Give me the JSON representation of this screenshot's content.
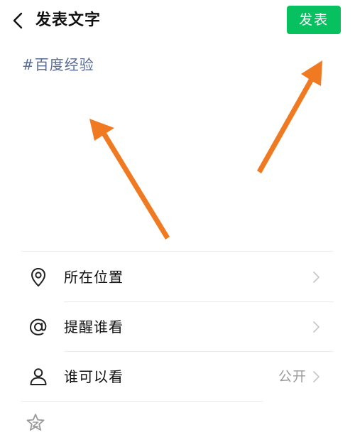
{
  "header": {
    "back_icon": "chevron-left-icon",
    "title": "发表文字",
    "publish_label": "发表",
    "publish_color": "#07c160"
  },
  "editor": {
    "text": "#百度经验",
    "text_color": "#576b95"
  },
  "options": [
    {
      "icon": "location-pin-icon",
      "label": "所在位置",
      "value": ""
    },
    {
      "icon": "at-sign-icon",
      "label": "提醒谁看",
      "value": ""
    },
    {
      "icon": "person-icon",
      "label": "谁可以看",
      "value": "公开"
    }
  ],
  "footer": {
    "icon": "star-icon"
  },
  "annotation": {
    "arrow_color": "#f07a21",
    "arrow_icons": [
      "arrow-up-left-icon",
      "arrow-up-right-icon"
    ]
  }
}
